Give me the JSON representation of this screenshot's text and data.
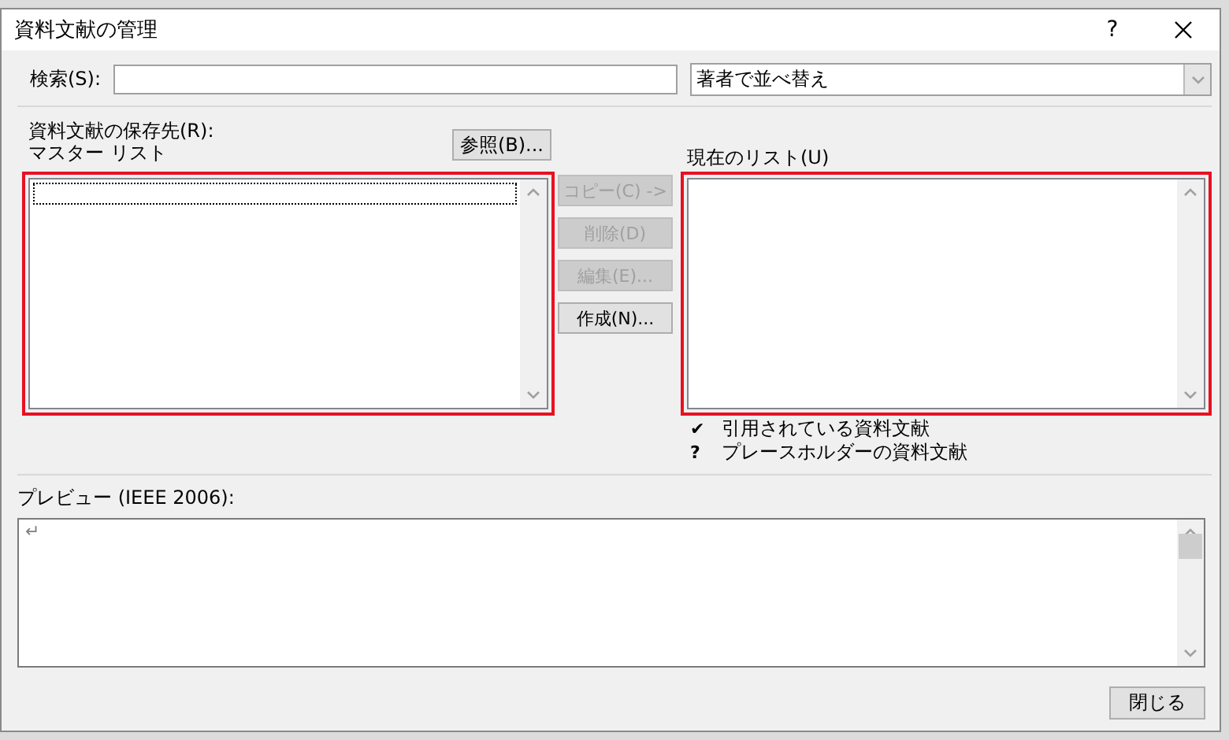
{
  "window": {
    "title": "資料文献の管理",
    "help": "?"
  },
  "search": {
    "label": "検索(S):"
  },
  "sort": {
    "value": "著者で並べ替え"
  },
  "source": {
    "label": "資料文献の保存先(R):",
    "browse": "参照(B)...",
    "list_label": "マスター リスト"
  },
  "master_list": {
    "highlighted": true,
    "focused": true
  },
  "actions": [
    {
      "label": "コピー(C) ->",
      "disabled": true
    },
    {
      "label": "削除(D)",
      "disabled": true
    },
    {
      "label": "編集(E)...",
      "disabled": true
    },
    {
      "label": "作成(N)...",
      "disabled": false
    }
  ],
  "current_list": {
    "label": "現在のリスト(U)",
    "highlighted": true,
    "focused": false
  },
  "legend": [
    {
      "symbol": "✔",
      "text": "引用されている資料文献"
    },
    {
      "symbol": "?",
      "text": "プレースホルダーの資料文献"
    }
  ],
  "preview": {
    "label": "プレビュー (IEEE 2006):",
    "content": "↵"
  },
  "close_button": "閉じる"
}
